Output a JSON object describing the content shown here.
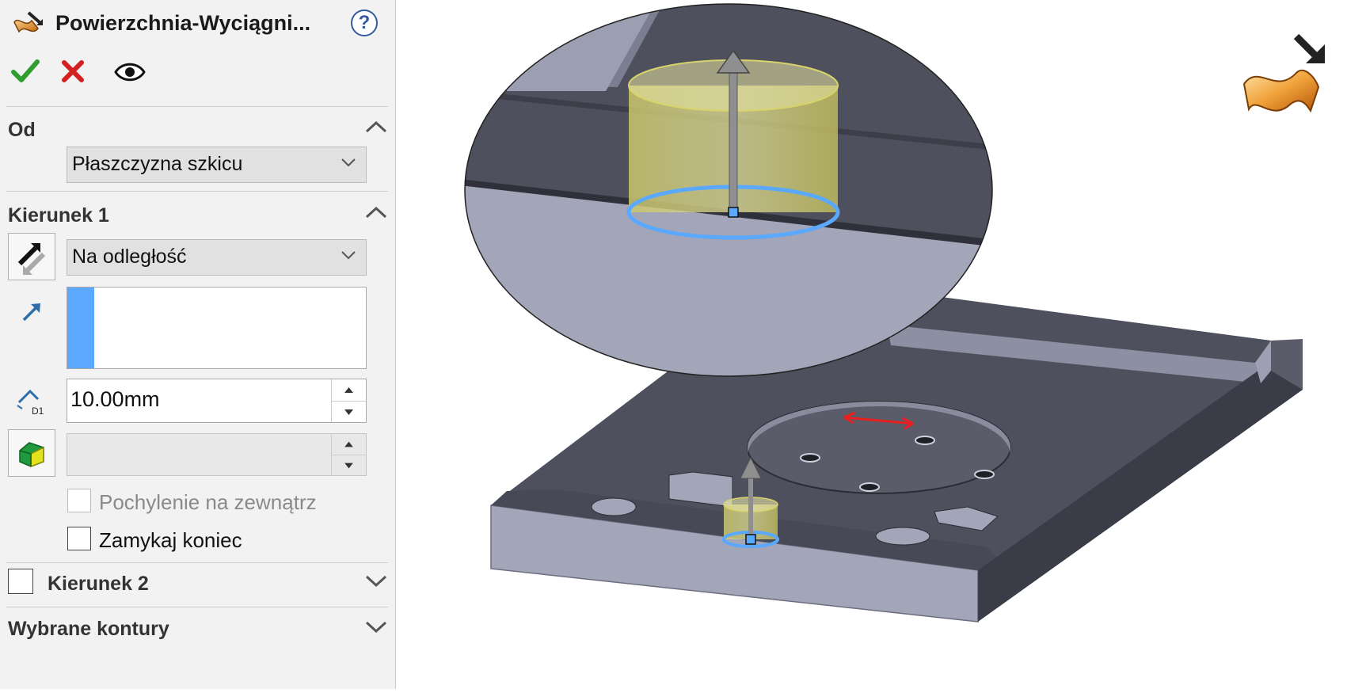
{
  "panel": {
    "title": "Powierzchnia-Wyciągni...",
    "help_label": "?",
    "actions": [
      {
        "name": "ok",
        "icon": "checkmark-icon"
      },
      {
        "name": "cancel",
        "icon": "cross-icon"
      },
      {
        "name": "preview",
        "icon": "eye-icon"
      }
    ],
    "from": {
      "title": "Od",
      "selected": "Płaszczyzna szkicu"
    },
    "direction1": {
      "title": "Kierunek 1",
      "end_condition": "Na odległość",
      "distance": "10.00mm",
      "draft_value": "",
      "draft_outward_label": "Pochylenie na zewnątrz",
      "draft_outward_checked": false,
      "draft_outward_enabled": false,
      "cap_end_label": "Zamykaj koniec",
      "cap_end_checked": false
    },
    "direction2": {
      "title": "Kierunek 2",
      "checked": false
    },
    "selected_contours": {
      "title": "Wybrane kontury"
    }
  },
  "colors": {
    "ok_green": "#2f9e2f",
    "cancel_red": "#d32020",
    "selection_blue": "#5aa9ff",
    "preview_yellow": "#d8d36a",
    "part_dark": "#4e505d",
    "part_side": "#a3a5b8"
  },
  "viewport": {
    "feature_icon": "surface-extrude-icon"
  }
}
